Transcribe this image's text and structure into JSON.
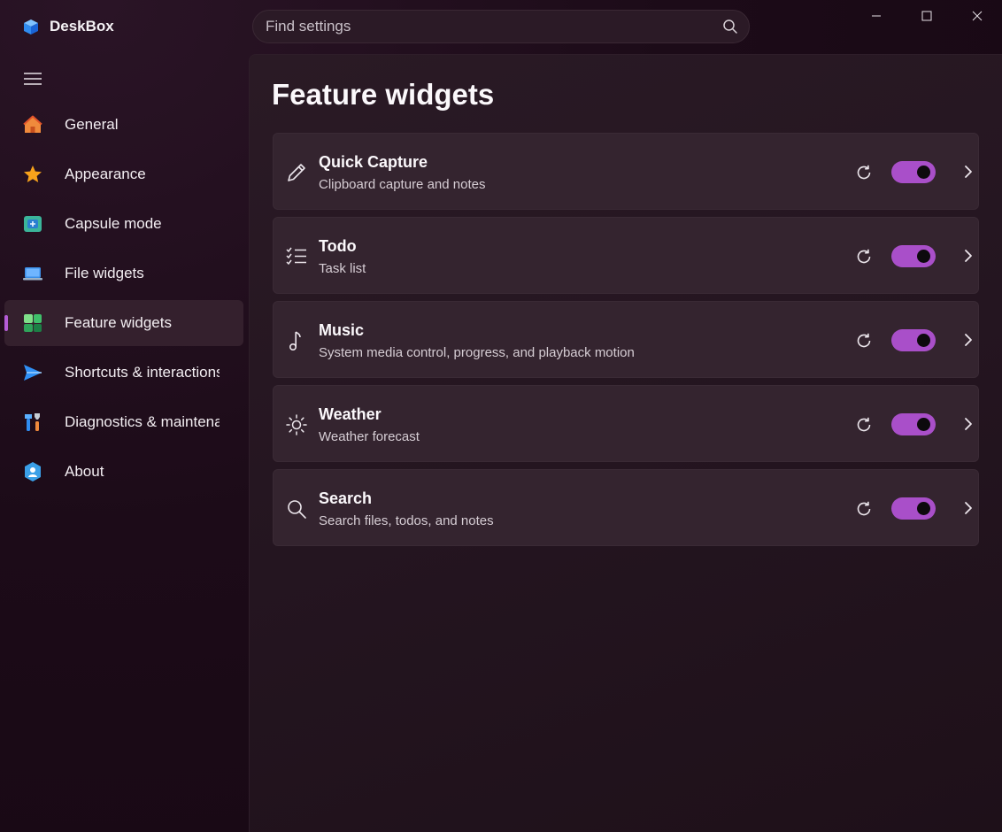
{
  "app": {
    "title": "DeskBox"
  },
  "search": {
    "placeholder": "Find settings"
  },
  "nav": {
    "items": [
      {
        "label": "General",
        "icon": "home-icon"
      },
      {
        "label": "Appearance",
        "icon": "star-icon"
      },
      {
        "label": "Capsule mode",
        "icon": "capsule-icon"
      },
      {
        "label": "File widgets",
        "icon": "laptop-icon"
      },
      {
        "label": "Feature widgets",
        "icon": "widgets-icon",
        "active": true
      },
      {
        "label": "Shortcuts & interactions",
        "icon": "send-icon"
      },
      {
        "label": "Diagnostics & maintenance",
        "icon": "tools-icon"
      },
      {
        "label": "About",
        "icon": "bot-icon"
      }
    ]
  },
  "page": {
    "title": "Feature widgets"
  },
  "widgets": [
    {
      "title": "Quick Capture",
      "subtitle": "Clipboard capture and notes",
      "icon": "pencil-icon",
      "enabled": true
    },
    {
      "title": "Todo",
      "subtitle": "Task list",
      "icon": "checklist-icon",
      "enabled": true
    },
    {
      "title": "Music",
      "subtitle": "System media control, progress, and playback motion",
      "icon": "music-note-icon",
      "enabled": true
    },
    {
      "title": "Weather",
      "subtitle": "Weather forecast",
      "icon": "sun-icon",
      "enabled": true
    },
    {
      "title": "Search",
      "subtitle": "Search files, todos, and notes",
      "icon": "search-icon",
      "enabled": true
    }
  ],
  "colors": {
    "accent": "#a94fc9",
    "background": "#1c0b18",
    "card": "#34242f"
  }
}
